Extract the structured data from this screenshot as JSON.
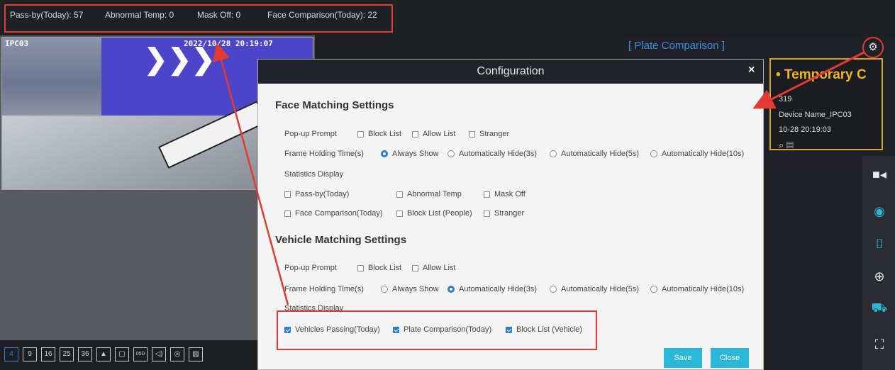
{
  "top_stats": [
    {
      "label": "Pass-by(Today): 57"
    },
    {
      "label": "Abnormal Temp: 0"
    },
    {
      "label": "Mask Off: 0"
    },
    {
      "label": "Face Comparison(Today): 22"
    }
  ],
  "video": {
    "camera_name": "IPC03",
    "timestamp": "2022/10/28 20:19:07"
  },
  "layout_buttons": [
    "4",
    "9",
    "16",
    "25",
    "36",
    "▲",
    "▢",
    "05D",
    "◁)",
    "◎",
    "▨"
  ],
  "right_panel": {
    "title": "[ Plate Comparison ]",
    "settings_icon": "gear-icon",
    "card": {
      "title": "• Temporary C",
      "line1": "319",
      "line2": "Device Name_IPC03",
      "line3": "10-28 20:19:03"
    },
    "side_icons": [
      "video-icon",
      "face-icon",
      "face-capture-icon",
      "target-icon",
      "vehicle-icon",
      "fullscreen-icon"
    ]
  },
  "dialog": {
    "title": "Configuration",
    "close": "×",
    "face": {
      "heading": "Face Matching Settings",
      "popup_label": "Pop-up Prompt",
      "popup_options": [
        "Block List",
        "Allow List",
        "Stranger"
      ],
      "hold_label": "Frame Holding Time(s)",
      "hold_options": [
        "Always Show",
        "Automatically Hide(3s)",
        "Automatically Hide(5s)",
        "Automatically Hide(10s)"
      ],
      "stats_label": "Statistics Display",
      "stats_row1": [
        "Pass-by(Today)",
        "Abnormal Temp",
        "Mask Off"
      ],
      "stats_row2": [
        "Face Comparison(Today)",
        "Block List (People)",
        "Stranger"
      ]
    },
    "vehicle": {
      "heading": "Vehicle Matching Settings",
      "popup_label": "Pop-up Prompt",
      "popup_options": [
        "Block List",
        "Allow List"
      ],
      "hold_label": "Frame Holding Time(s)",
      "hold_options": [
        "Always Show",
        "Automatically Hide(3s)",
        "Automatically Hide(5s)",
        "Automatically Hide(10s)"
      ],
      "stats_label": "Statistics Display",
      "stats_options": [
        "Vehicles Passing(Today)",
        "Plate Comparison(Today)",
        "Block List (Vehicle)"
      ]
    },
    "save": "Save",
    "close_button": "Close"
  },
  "colors": {
    "accent": "#2ab7d8",
    "highlight": "#e53935",
    "card_gold": "#f2b51b",
    "link_blue": "#3a8ee6"
  }
}
